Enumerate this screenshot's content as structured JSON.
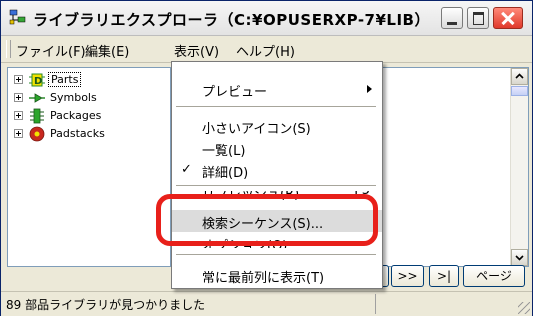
{
  "window": {
    "title": "ライブラリエクスプローラ（C:¥OPUSERXP-7¥LIB）"
  },
  "menubar": {
    "file": "ファイル(F)",
    "edit": "編集(E)",
    "view": "表示(V)",
    "help": "ヘルプ(H)"
  },
  "tree": {
    "items": [
      {
        "label": "Parts",
        "icon": "parts-icon"
      },
      {
        "label": "Symbols",
        "icon": "symbols-icon"
      },
      {
        "label": "Packages",
        "icon": "packages-icon"
      },
      {
        "label": "Padstacks",
        "icon": "padstacks-icon"
      }
    ]
  },
  "menu": {
    "preview": "プレビュー",
    "small_icons": "小さいアイコン(S)",
    "list": "一覧(L)",
    "details": "詳細(D)",
    "refresh": "リフレッシュ(R)",
    "refresh_shortcut": "F5",
    "search_sequence": "検索シーケンス(S)...",
    "options": "オプション(O)...",
    "always_on_top": "常に最前列に表示(T)"
  },
  "nav": {
    "prev": "‹",
    "next": ">>",
    "last": ">|",
    "page": "ページ"
  },
  "status": {
    "text": "89 部品ライブラリが見つかりました"
  },
  "colors": {
    "highlight_ring": "#e8201a"
  }
}
